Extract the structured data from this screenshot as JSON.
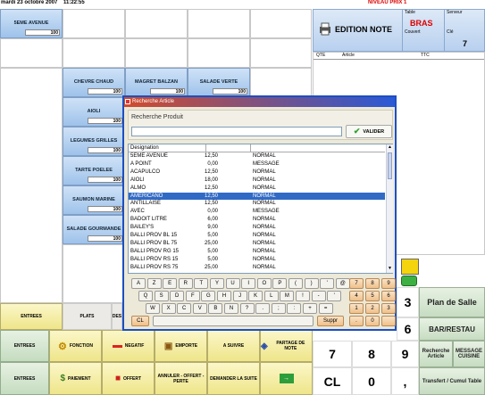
{
  "topbar": {
    "date": "mardi 23 octobre 2007",
    "time": "11:22:55",
    "level": "NIVEAU PRIX 1"
  },
  "grid": {
    "seme": {
      "label": "5EME AVENUE",
      "qty": "100"
    }
  },
  "products": [
    {
      "label": "CHEVRE CHAUD",
      "qty": "100"
    },
    {
      "label": "MAGRET BALZAN",
      "qty": "100"
    },
    {
      "label": "SALADE VERTE",
      "qty": "100"
    },
    {
      "label": "AIOLI",
      "qty": "100"
    },
    {
      "label": "LEGUMES GRILLES",
      "qty": "100"
    },
    {
      "label": "TARTE POELEE",
      "qty": "100"
    },
    {
      "label": "SAUMON MARINE",
      "qty": "100"
    },
    {
      "label": "SALADE GOURMANDE",
      "qty": "100"
    }
  ],
  "edition": {
    "label": "EDITION NOTE",
    "table_label": "Table",
    "table_value": "BRAS",
    "server_label": "Serveur",
    "covers_label": "Couvert",
    "client_label": "Clé",
    "count": "7"
  },
  "ticket": {
    "cols": [
      "QTE",
      "Article",
      "TTC"
    ]
  },
  "dialog": {
    "title": "Recherche Article",
    "search_label": "Recherche Produit",
    "search_value": "",
    "valider": "VALIDER",
    "col_designation": "Designation",
    "rows": [
      {
        "name": "5EME AVENUE",
        "price": "12,50",
        "type": "NORMAL"
      },
      {
        "name": "A POINT",
        "price": "0,00",
        "type": "MESSAGE"
      },
      {
        "name": "ACAPULCO",
        "price": "12,50",
        "type": "NORMAL"
      },
      {
        "name": "AIOLI",
        "price": "18,00",
        "type": "NORMAL"
      },
      {
        "name": "ALMO",
        "price": "12,50",
        "type": "NORMAL"
      },
      {
        "name": "AMERICANO",
        "price": "12,50",
        "type": "NORMAL"
      },
      {
        "name": "ANTILLAISE",
        "price": "12,50",
        "type": "NORMAL"
      },
      {
        "name": "AVEC",
        "price": "0,00",
        "type": "MESSAGE"
      },
      {
        "name": "BADOIT LITRE",
        "price": "6,00",
        "type": "NORMAL"
      },
      {
        "name": "BAILEY'S",
        "price": "9,00",
        "type": "NORMAL"
      },
      {
        "name": "BALLI PROV BL 15",
        "price": "5,00",
        "type": "NORMAL"
      },
      {
        "name": "BALLI PROV BL 75",
        "price": "25,00",
        "type": "NORMAL"
      },
      {
        "name": "BALLI PROV RG 15",
        "price": "5,00",
        "type": "NORMAL"
      },
      {
        "name": "BALLI PROV RS 15",
        "price": "5,00",
        "type": "NORMAL"
      },
      {
        "name": "BALLI PROV RS 75",
        "price": "25,00",
        "type": "NORMAL"
      }
    ],
    "keys_row1": [
      "A",
      "Z",
      "E",
      "R",
      "T",
      "Y",
      "U",
      "I",
      "O",
      "P",
      "(",
      ")",
      "'",
      "@"
    ],
    "keys_row2": [
      "Q",
      "S",
      "D",
      "F",
      "G",
      "H",
      "J",
      "K",
      "L",
      "M",
      "!",
      "-",
      "'"
    ],
    "keys_row3": [
      "W",
      "X",
      "C",
      "V",
      "B",
      "N",
      "?",
      ".",
      ";",
      ":",
      "+",
      "="
    ],
    "numpad": [
      "7",
      "8",
      "9",
      "4",
      "5",
      "6",
      "1",
      "2",
      "3",
      ".",
      "0"
    ],
    "cl": "CL",
    "suppr": "Suppr"
  },
  "bottom": {
    "row1": [
      "ENTREES",
      "PLATS",
      "DES"
    ],
    "row2": {
      "entrees": "ENTREES",
      "fonction": "FONCTION",
      "negatif": "NEGATIF",
      "emporte": "EMPORTE",
      "a_suivre": "A SUIVRE",
      "partage": "PARTAGE DE NOTE"
    },
    "row3": {
      "entrees": "ENTREES",
      "paiement": "PAIEMENT",
      "offert": "OFFERT",
      "annuler": "ANNULER - OFFERT - PERTE",
      "demander": "DEMANDER LA SUITE"
    }
  },
  "numpad_main": {
    "r1": [
      "3"
    ],
    "r2": [
      "6"
    ],
    "r3": [
      "7",
      "8",
      "9"
    ],
    "r4": [
      "CL",
      "0",
      ","
    ]
  },
  "right_buttons": {
    "plan": "Plan de Salle",
    "bar": "BAR/RESTAU",
    "recherche": "Recherche Article",
    "message": "MESSAGE CUISINE",
    "transfert": "Transfert / Cumul Table"
  }
}
